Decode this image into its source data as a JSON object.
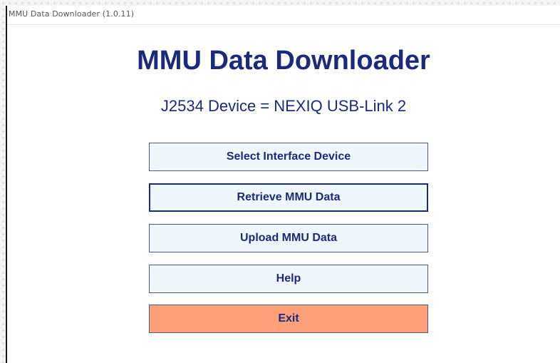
{
  "window": {
    "title": "MMU Data Downloader (1.0.11)"
  },
  "header": {
    "title": "MMU Data Downloader",
    "device_line": "J2534 Device = NEXIQ USB-Link 2"
  },
  "buttons": [
    {
      "id": "select-interface-device",
      "label": "Select Interface Device",
      "focused": false
    },
    {
      "id": "retrieve-mmu-data",
      "label": "Retrieve MMU Data",
      "focused": true
    },
    {
      "id": "upload-mmu-data",
      "label": "Upload MMU Data",
      "focused": false
    },
    {
      "id": "help",
      "label": "Help",
      "focused": false
    },
    {
      "id": "exit",
      "label": "Exit",
      "focused": false
    }
  ],
  "colors": {
    "text_accent": "#1b2a7a",
    "button_bg": "#f0f7fc",
    "exit_bg": "#ffa07a"
  }
}
